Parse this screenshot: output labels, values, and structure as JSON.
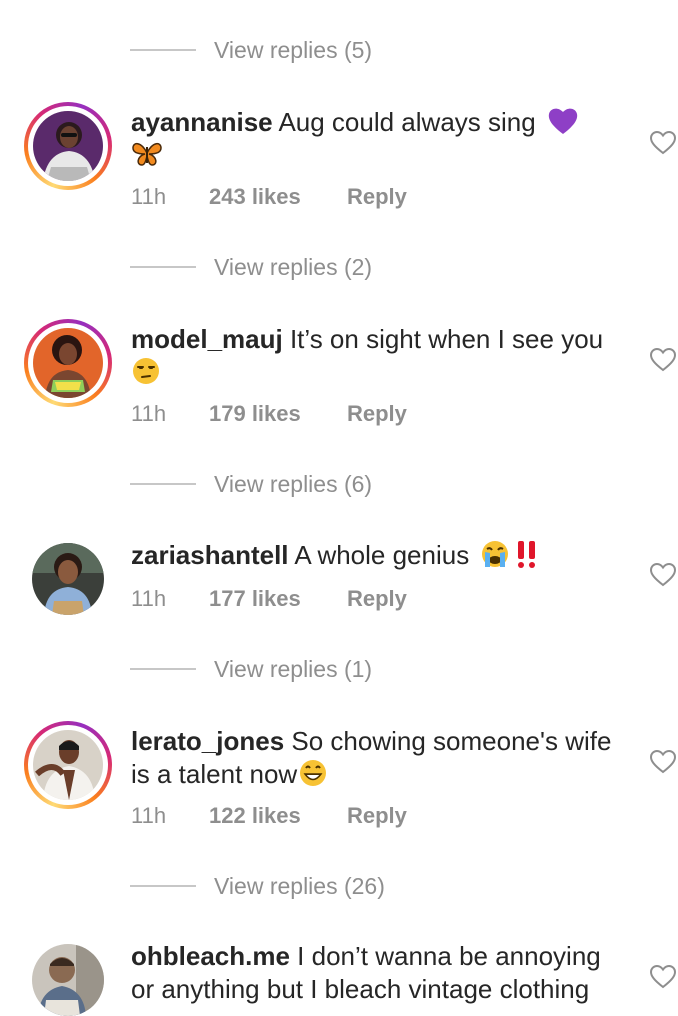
{
  "threads": [
    {
      "view_replies": "View replies (5)"
    },
    {
      "username": "ayannanise",
      "text": "Aug could always sing",
      "emojis": [
        "purple-heart",
        "butterfly"
      ],
      "time": "11h",
      "likes": "243 likes",
      "reply": "Reply",
      "view_replies": "View replies (2)"
    },
    {
      "username": "model_mauj",
      "text": "It’s on sight when I see you",
      "emojis": [
        "unamused-face"
      ],
      "time": "11h",
      "likes": "179 likes",
      "reply": "Reply",
      "view_replies": "View replies (6)"
    },
    {
      "username": "zariashantell",
      "text": "A whole genius",
      "emojis": [
        "crying-face",
        "double-exclamation"
      ],
      "time": "11h",
      "likes": "177 likes",
      "reply": "Reply",
      "view_replies": "View replies (1)"
    },
    {
      "username": "lerato_jones",
      "text": "So chowing someone's wife is a talent now",
      "emojis": [
        "grinning-face"
      ],
      "time": "11h",
      "likes": "122 likes",
      "reply": "Reply",
      "view_replies": "View replies (26)"
    },
    {
      "username": "ohbleach.me",
      "text": "I don’t wanna be annoying or anything but I bleach vintage clothing"
    }
  ],
  "colors": {
    "text": "#262626",
    "muted": "#8e8e8e",
    "divider": "#c7c7c7",
    "heart": "#8e8e8e"
  }
}
